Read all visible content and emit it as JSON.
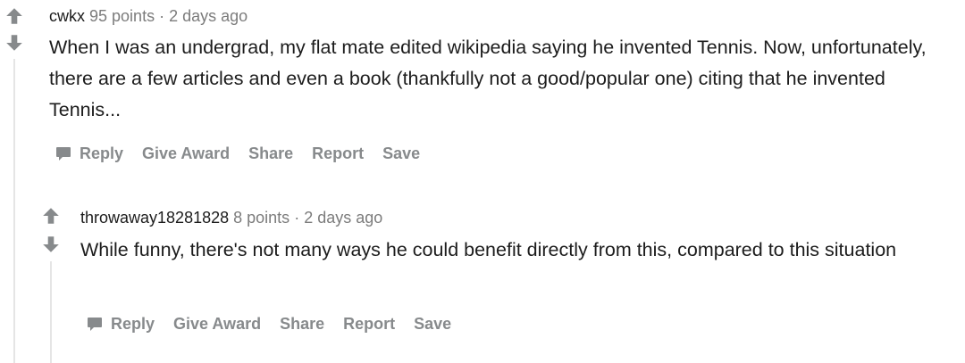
{
  "comments": [
    {
      "author": "cwkx",
      "points": "95 points",
      "separator": "·",
      "time": "2 days ago",
      "body": "When I was an undergrad, my flat mate edited wikipedia saying he invented Tennis. Now, unfortunately, there are a few articles and even a book (thankfully not a good/popular one) citing that he invented Tennis...",
      "actions": {
        "reply": "Reply",
        "give_award": "Give Award",
        "share": "Share",
        "report": "Report",
        "save": "Save"
      }
    },
    {
      "author": "throwaway18281828",
      "points": "8 points",
      "separator": "·",
      "time": "2 days ago",
      "body": "While funny, there's not many ways he could benefit directly from this, compared to this situation",
      "actions": {
        "reply": "Reply",
        "give_award": "Give Award",
        "share": "Share",
        "report": "Report",
        "save": "Save"
      }
    }
  ],
  "icons": {
    "upvote": "upvote-arrow-icon",
    "downvote": "downvote-arrow-icon",
    "reply": "comment-bubble-icon"
  },
  "colors": {
    "text": "#1c1c1c",
    "meta": "#7c7c7c",
    "action": "#878a8c",
    "thread_line": "#e5e5e5",
    "arrow": "#878a8c"
  }
}
